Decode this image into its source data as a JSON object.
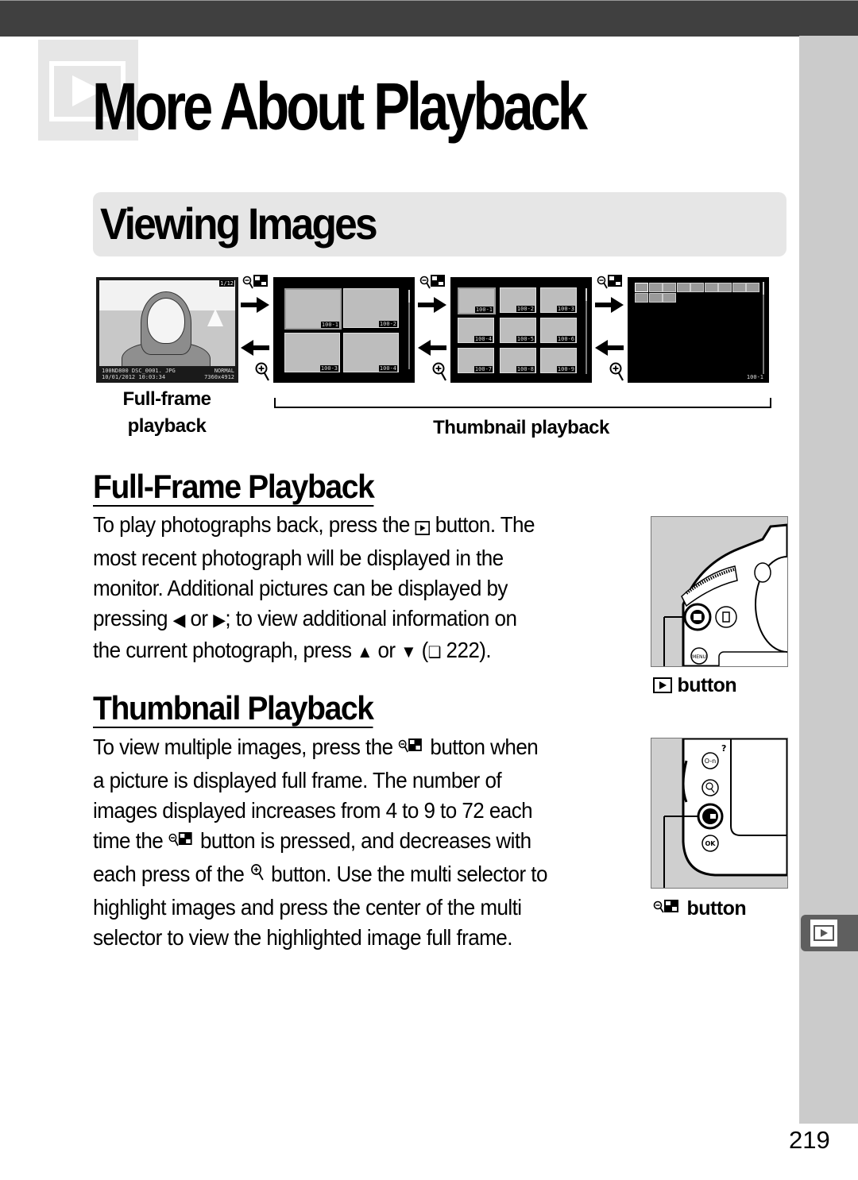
{
  "chapter": {
    "title": "More About Playback",
    "icon": "playback-icon"
  },
  "section": {
    "title": "Viewing Images"
  },
  "diagram": {
    "screens": [
      {
        "kind": "full-frame",
        "frame_counter": "1/12",
        "info_line1_left": "100ND800  DSC_0001. JPG",
        "info_line1_right": "NORMAL",
        "info_line2_left": "10/01/2012  10:03:34",
        "info_line2_right": "7360x4912"
      },
      {
        "kind": "thumbnails-4",
        "labels": [
          "100-1",
          "100-2",
          "100-3",
          "100-4"
        ]
      },
      {
        "kind": "thumbnails-9",
        "labels": [
          "100-1",
          "100-2",
          "100-3",
          "100-4",
          "100-5",
          "100-6",
          "100-7",
          "100-8",
          "100-9"
        ]
      },
      {
        "kind": "thumbnails-72",
        "visible_thumbnails": 12,
        "footer_label": "100-1"
      }
    ],
    "arrow_forward_icon": "zoom-out-thumbnail-icon",
    "arrow_back_icon": "zoom-in-icon",
    "caption_fullframe_line1": "Full-frame",
    "caption_fullframe_line2": "playback",
    "caption_thumbnail": "Thumbnail playback"
  },
  "full_frame": {
    "heading": "Full-Frame Playback",
    "lines": [
      [
        "To play photographs back, press the ",
        "{playback-icon}",
        " button.  The"
      ],
      [
        "most recent photograph will be displayed in the"
      ],
      [
        "monitor. Additional pictures can be displayed by"
      ],
      [
        "pressing ",
        "◀",
        " or ",
        "▶",
        "; to view additional information on"
      ],
      [
        "the current photograph, press ",
        "▲",
        " or ",
        "▼",
        " (",
        "🕮",
        " 222)."
      ]
    ],
    "page_ref": "222",
    "figure_caption": "button",
    "figure_caption_icon": "playback-icon"
  },
  "thumbnail": {
    "heading": "Thumbnail Playback",
    "lines": [
      [
        "To view multiple images, press the ",
        "{thumb-icon}",
        " button when"
      ],
      [
        "a picture is displayed full frame. The number of"
      ],
      [
        "images displayed increases from 4 to 9 to 72 each"
      ],
      [
        "time the ",
        "{thumb-icon}",
        " button is pressed, and decreases with"
      ],
      [
        "each press of the ",
        "{zoomin-icon}",
        " button. Use the multi selector to"
      ],
      [
        "highlight images and press the center of the multi"
      ],
      [
        "selector to view the highlighted image full frame."
      ]
    ],
    "counts": [
      4,
      9,
      72
    ],
    "figure_caption": "button",
    "figure_caption_icon": "zoom-out-thumbnail-icon"
  },
  "side_tab": {
    "icon": "playback-icon"
  },
  "page_number": "219",
  "colors": {
    "top_bar": "#404040",
    "side_strip": "#cbcbcb",
    "side_tab": "#5f5f5f",
    "section_bar": "#e6e6e6",
    "text": "#000000"
  }
}
